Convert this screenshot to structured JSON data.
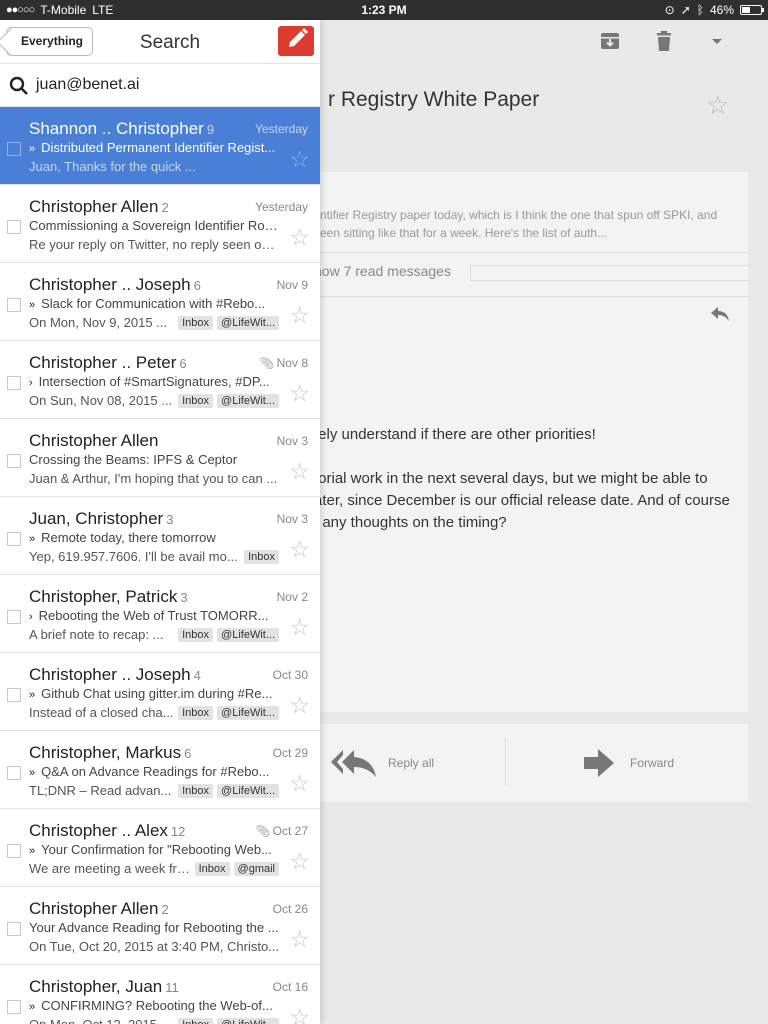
{
  "status_bar": {
    "carrier": "T-Mobile",
    "network": "LTE",
    "time": "1:23 PM",
    "battery": "46%",
    "battery_level": 0.46
  },
  "list_header": {
    "back_label": "Everything",
    "title": "Search"
  },
  "search": {
    "query": "juan@benet.ai"
  },
  "threads": [
    {
      "sender": "Shannon .. Christopher",
      "count": "9",
      "date": "Yesterday",
      "subject": "Distributed Permanent Identifier Regist...",
      "important": "»",
      "snippet": "Juan, Thanks for the quick ...",
      "labels": [],
      "attachment": false,
      "selected": true
    },
    {
      "sender": "Christopher Allen",
      "count": "2",
      "date": "Yesterday",
      "subject": "Commissioning a Sovereign Identifier Roo...",
      "important": "",
      "snippet": "Re your reply on Twitter, no reply seen on t...",
      "labels": [],
      "attachment": false,
      "selected": false
    },
    {
      "sender": "Christopher .. Joseph",
      "count": "6",
      "date": "Nov 9",
      "subject": "Slack for Communication with #Rebo...",
      "important": "»",
      "snippet": "On Mon, Nov 9, 2015 ...",
      "labels": [
        "Inbox",
        "@LifeWit..."
      ],
      "attachment": false,
      "selected": false
    },
    {
      "sender": "Christopher .. Peter",
      "count": "6",
      "date": "Nov 8",
      "subject": "Intersection of #SmartSignatures, #DP...",
      "important": "›",
      "snippet": "On Sun, Nov 08, 2015 ...",
      "labels": [
        "Inbox",
        "@LifeWit..."
      ],
      "attachment": true,
      "selected": false
    },
    {
      "sender": "Christopher Allen",
      "count": "",
      "date": "Nov 3",
      "subject": "Crossing the Beams: IPFS & Ceptor",
      "important": "",
      "snippet": "Juan & Arthur, I'm hoping that you to can ...",
      "labels": [],
      "attachment": false,
      "selected": false
    },
    {
      "sender": "Juan, Christopher",
      "count": "3",
      "date": "Nov 3",
      "subject": "Remote today, there tomorrow",
      "important": "»",
      "snippet": "Yep, 619.957.7606. I'll be avail mo...",
      "labels": [
        "Inbox"
      ],
      "attachment": false,
      "selected": false
    },
    {
      "sender": "Christopher, Patrick",
      "count": "3",
      "date": "Nov 2",
      "subject": "Rebooting the Web of Trust TOMORR...",
      "important": "›",
      "snippet": "A brief note to recap: ...",
      "labels": [
        "Inbox",
        "@LifeWit..."
      ],
      "attachment": false,
      "selected": false
    },
    {
      "sender": "Christopher .. Joseph",
      "count": "4",
      "date": "Oct 30",
      "subject": "Github Chat using gitter.im during #Re...",
      "important": "»",
      "snippet": "Instead of a closed cha...",
      "labels": [
        "Inbox",
        "@LifeWit..."
      ],
      "attachment": false,
      "selected": false
    },
    {
      "sender": "Christopher, Markus",
      "count": "6",
      "date": "Oct 29",
      "subject": "Q&A on Advance Readings for #Rebo...",
      "important": "»",
      "snippet": "TL;DNR – Read advan...",
      "labels": [
        "Inbox",
        "@LifeWit..."
      ],
      "attachment": false,
      "selected": false
    },
    {
      "sender": "Christopher .. Alex",
      "count": "12",
      "date": "Oct 27",
      "subject": "Your Confirmation for \"Rebooting Web...",
      "important": "»",
      "snippet": "We are meeting a week fro...",
      "labels": [
        "Inbox",
        "@gmail"
      ],
      "attachment": true,
      "selected": false
    },
    {
      "sender": "Christopher Allen",
      "count": "2",
      "date": "Oct 26",
      "subject": "Your Advance Reading for Rebooting the ...",
      "important": "",
      "snippet": "On Tue, Oct 20, 2015 at 3:40 PM, Christo...",
      "labels": [],
      "attachment": false,
      "selected": false
    },
    {
      "sender": "Christopher, Juan",
      "count": "11",
      "date": "Oct 16",
      "subject": "CONFIRMING? Rebooting the Web-of...",
      "important": "»",
      "snippet": "On Mon, Oct 12, 2015 ...",
      "labels": [
        "Inbox",
        "@LifeWit..."
      ],
      "attachment": false,
      "selected": false
    }
  ],
  "reading_pane": {
    "subject": "r Registry White Paper",
    "collapsed_snippet_line1": "ntifier Registry paper today, which is I think the one that spun off SPKI, and",
    "collapsed_snippet_line2": "een sitting like that for a week. Here's the list of auth...",
    "show_read": "how 7 read messages",
    "body_line1": "tely understand if there are other priorities!",
    "body_line2": "torial work in the next several days, but we might be able to",
    "body_line3": "ater, since December is our official release date. And of course",
    "body_line4": ", any thoughts on the timing?",
    "reply_all": "Reply all",
    "forward": "Forward"
  },
  "colors": {
    "selected_row": "#4a7fd8",
    "compose": "#dd3b2f"
  }
}
